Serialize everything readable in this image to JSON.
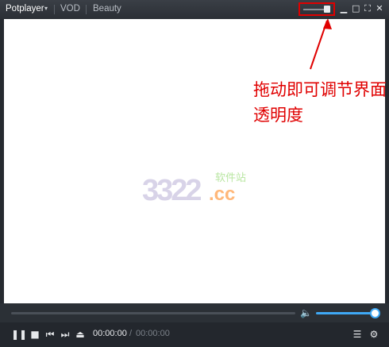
{
  "titlebar": {
    "app_name": "Potplayer",
    "tabs": [
      {
        "label": "VOD"
      },
      {
        "label": "Beauty"
      }
    ],
    "icons": {
      "menu": "chevron-down-icon",
      "minimize": "minimize-icon",
      "maximize": "maximize-icon",
      "fullscreen": "fullscreen-icon",
      "close": "close-icon"
    }
  },
  "opacity_slider": {
    "level": 0.85
  },
  "annotation": {
    "text": "拖动即可调节界面透明度",
    "color": "#e00000"
  },
  "watermark": {
    "number": "3322",
    "domain": ".cc",
    "chinese": "软件站"
  },
  "playback": {
    "current_time": "00:00:00",
    "separator": "/",
    "total_time": "00:00:00",
    "seek_progress": 0,
    "volume": 1.0
  },
  "controls": {
    "icons": [
      "pause-icon",
      "stop-icon",
      "previous-icon",
      "next-icon",
      "eject-icon",
      "playlist-icon",
      "settings-icon"
    ]
  },
  "colors": {
    "accent": "#3fa9f5",
    "annotation": "#e00000",
    "background": "#262a30"
  }
}
